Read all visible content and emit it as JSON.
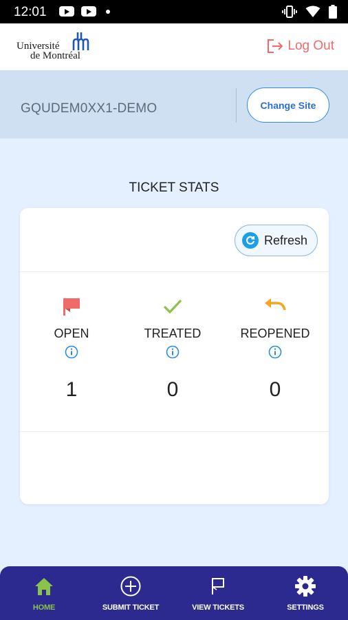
{
  "status_bar": {
    "time": "12:01"
  },
  "header": {
    "logo_line1": "Université",
    "logo_line2": "de Montréal",
    "logout_label": "Log Out"
  },
  "site": {
    "name": "GQUDEM0XX1-DEMO",
    "change_label": "Change Site"
  },
  "stats": {
    "title": "TICKET STATS",
    "refresh_label": "Refresh",
    "items": [
      {
        "label": "OPEN",
        "value": "1",
        "icon": "flag-icon",
        "color": "#f06a6a"
      },
      {
        "label": "TREATED",
        "value": "0",
        "icon": "check-icon",
        "color": "#8bc24a"
      },
      {
        "label": "REOPENED",
        "value": "0",
        "icon": "undo-icon",
        "color": "#f5a623"
      }
    ]
  },
  "nav": {
    "items": [
      {
        "label": "HOME",
        "icon": "home-icon",
        "active": true
      },
      {
        "label": "SUBMIT TICKET",
        "icon": "plus-circle-icon",
        "active": false
      },
      {
        "label": "VIEW TICKETS",
        "icon": "flag-outline-icon",
        "active": false
      },
      {
        "label": "SETTINGS",
        "icon": "gear-icon",
        "active": false
      }
    ]
  },
  "colors": {
    "accent_blue": "#2b8ce0",
    "nav_bg": "#2c2a8f",
    "nav_active": "#8bc24a",
    "logout": "#f06a6a"
  }
}
